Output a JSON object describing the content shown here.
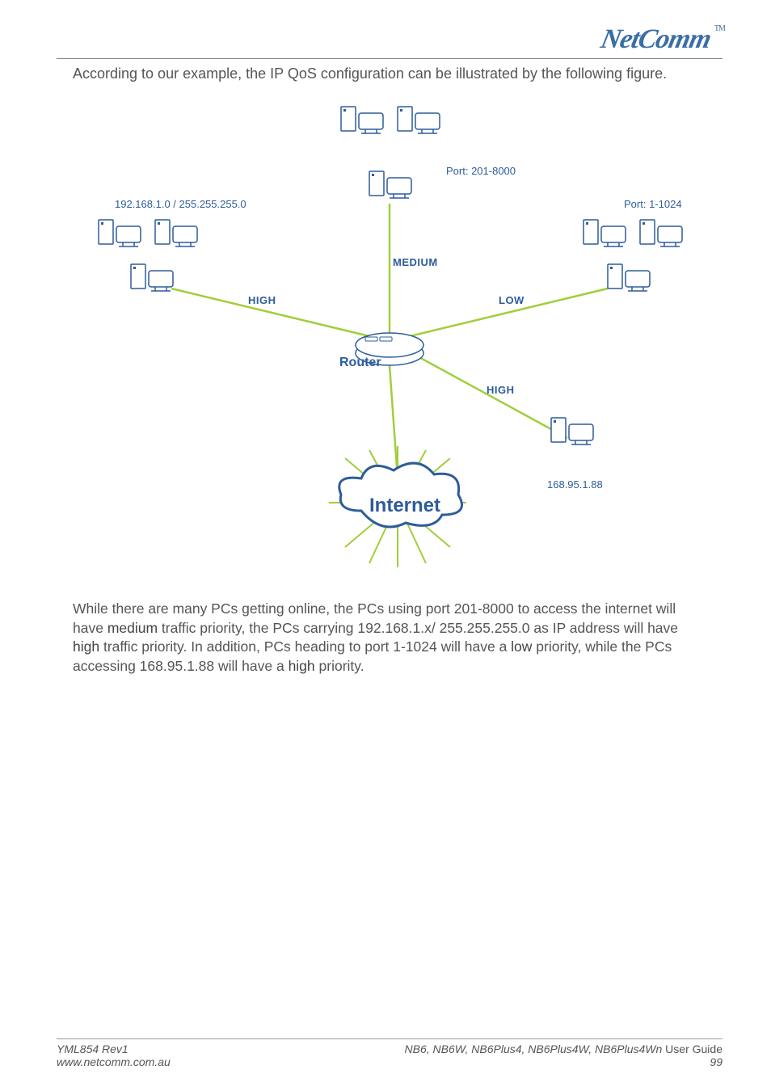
{
  "header": {
    "logo_text": "NetComm",
    "logo_tm": "TM"
  },
  "intro": "According to our example, the IP QoS configuration can be illustrated by the following figure.",
  "diagram": {
    "router_label": "Router",
    "internet_label": "Internet",
    "priorities": {
      "high": "HIGH",
      "medium": "MEDIUM",
      "low": "LOW"
    },
    "groups": {
      "left": {
        "annotation": "192.168.1.0 / 255.255.255.0",
        "priority": "HIGH"
      },
      "top": {
        "annotation": "Port: 201-8000",
        "priority": "MEDIUM"
      },
      "right": {
        "annotation": "Port: 1-1024",
        "priority": "LOW"
      },
      "bottomRight": {
        "annotation": "168.95.1.88",
        "priority": "HIGH"
      }
    }
  },
  "paragraph": {
    "p1": "While there are many PCs getting online, the PCs using port 201-8000 to access the internet will have ",
    "b1": "medium",
    "p2": " traffic priority, the PCs carrying 192.168.1.x/ 255.255.255.0 as IP address will have ",
    "b2": "high",
    "p3": " traffic priority. In addition, PCs heading to port 1-1024 will have a ",
    "b3": "low",
    "p4": " priority, while the PCs accessing 168.95.1.88 will have a ",
    "b4": "high",
    "p5": " priority."
  },
  "footer": {
    "left_line1": "YML854 Rev1",
    "left_line2": "www.netcomm.com.au",
    "right_models": "NB6, NB6W, NB6Plus4, NB6Plus4W, NB6Plus4Wn",
    "right_suffix": " User Guide",
    "page_number": "99"
  }
}
